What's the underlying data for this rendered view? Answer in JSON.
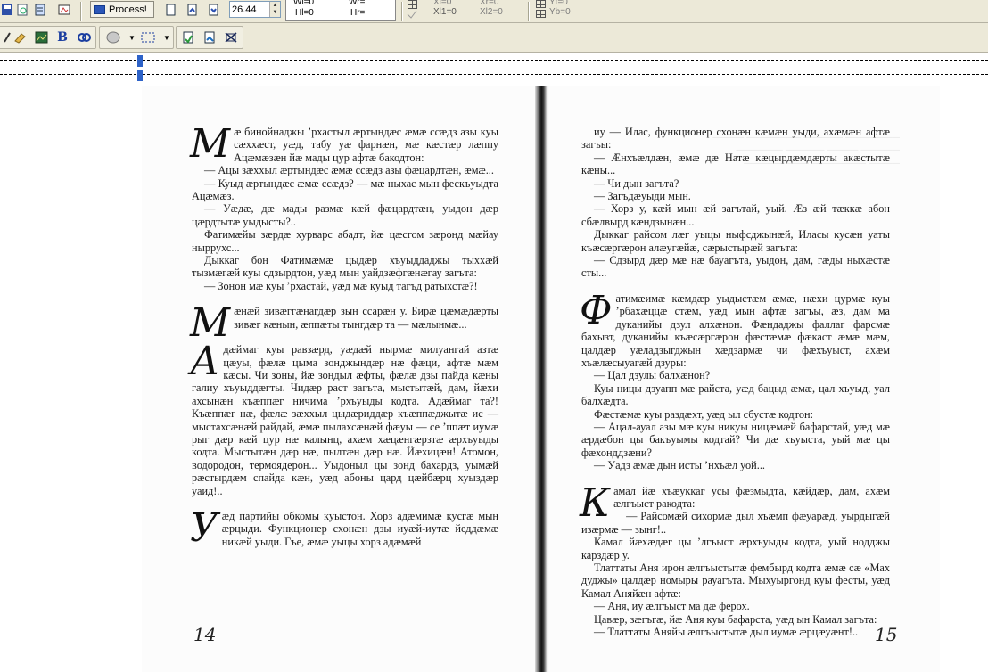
{
  "toolbar1": {
    "process_label": "Process!",
    "zoom_value": "26.44",
    "wl": "Wl=0",
    "hl": "Hl=0",
    "wr": "Wr=",
    "hr": "Hr=",
    "xl": "Xl=0",
    "xl1": "Xl1=0",
    "xl2": "Xl2=0",
    "xr": "Xr=0",
    "yt": "Yt=0",
    "yb": "Yb=0"
  },
  "page_left": {
    "page_number": "14",
    "sections": [
      {
        "dropcap": "М",
        "paragraphs": [
          "æ бинойнаджы ’рхастыл æртындæс æмæ ссæдз азы куы сæххæст, уæд, табу уæ фарнæн, мæ кæстæр лæппу Ацæмæзæн йæ мады цур афтæ бакодтон:",
          "— Ацы зæххыл æртындæс æмæ ссæдз азы фæцардтæн, æмæ...",
          "— Куыд æртындæс æмæ ссæдз? — мæ ныхас мын фескъуыдта Ацæмæз.",
          "— Уæдæ, дæ мады размæ кæй фæцардтæн, уыдон дæр цæрдтытæ уыдысты?..",
          "Фатимæйы зæрдæ хурварс абадт, йæ цæсгом зæронд мæйау ныррухс...",
          "Дыккаг бон Фатимæмæ цыдæр хъуыддаджы тыххæй тызмæгæй куы сдзырдтон, уæд мын уайдзæфгæнæгау загъта:",
          "— Зонон мæ куы ’рхастай, уæд мæ куыд тагъд ратыхстæ?!"
        ]
      },
      {
        "dropcap": "М",
        "paragraphs": [
          "æнæй зивæггæнагдæр зын ссарæн у. Бирæ цæмæдæрты зивæг кæнын, æппæты тынгдæр та — мæлынмæ..."
        ]
      },
      {
        "dropcap": "А",
        "paragraphs": [
          "дæймаг куы равзæрд, уæдæй нырмæ милуангай азтæ цæуы, фæлæ цыма зонджындæр нæ фæци, афтæ мæм кæсы. Чи зоны, йæ зондыл æфты, фæлæ дзы пайда кæны галиу хъуыддæгты. Чидæр раст загъта, мыстытæй, дам, йæхи ахсынæн къæппæг ничима ’рхъуыды кодта. Адæймаг та?! Къæппæг нæ, фæлæ зæххыл цыдæриддæр къæппæджытæ ис — мыстахсæнæй райдай, æмæ пылахсæнæй фæуы — се ’ппæт иумæ рыг дæр кæй цур нæ калынц, ахæм хæцæнгæрзтæ æрхъуыды кодта. Мыстытæн дæр нæ, пылтæн дæр нæ. Йæхицæн! Атомон, водородон, термоядерон... Уыдоныл цы зонд бахардз, уымæй рæстырдæм спайда кæн, уæд абоны цард цæйбæрц хуыздæр уаид!.."
        ]
      },
      {
        "dropcap": "У",
        "paragraphs": [
          "æд партийы обкомы куыстон. Хорз адæмимæ кусгæ мын æрцыди. Функционер схонæн дзы иуæй-иутæ йеддæмæ никæй уыди. Гъе, æмæ уыцы хорз адæмæй"
        ]
      }
    ]
  },
  "page_right": {
    "page_number": "15",
    "sections": [
      {
        "dropcap": "",
        "paragraphs": [
          "иу — Илас, функционер схонæн кæмæн уыди, ахæмæн афтæ загъы:",
          "— Æнхъæлдæн, æмæ дæ Натæ кæцырдæмдæрты акæстытæ кæны...",
          "— Чи дын загъта?",
          "— Загъдæуыди мын.",
          "— Хорз у, кæй мын æй загътай, уый. Æз æй тæккæ абон сбæлвырд кæндзынæн...",
          "Дыккаг райсом лæг уыцы ныфсджынæй, Иласы кусæн уаты къæсæргæрон алæугæйæ, сæрыстырæй загъта:",
          "— Сдзырд дæр мæ нæ бауагъта, уыдон, дам, гæды ныхæстæ сты..."
        ]
      },
      {
        "dropcap": "Ф",
        "paragraphs": [
          "атимæимæ кæмдæр уыдыстæм æмæ, нæхи цурмæ куы ’рбахæццæ стæм, уæд мын афтæ загъы, æз, дам ма дуканийы дзул алхæнон. Фæндаджы фаллаг фарсмæ бахызт, дуканийы къæсæргæрон фæстæмæ фæкаст æмæ мæм, цалдæр уæладзыгджын хæдзармæ чи фæхъуыст, ахæм хъæлæсыуагæй дзуры:",
          "— Цал дзулы балхæнон?",
          "Куы ницы дзуапп мæ райста, уæд бацыд æмæ, цал хъуыд, уал балхæдта.",
          "Фæстæмæ куы раздæхт, уæд ыл сбустæ кодтон:",
          "— Ацал-ауал азы мæ куы никуы ницæмæй бафарстай, уæд мæ æрдæбон цы бакъуымы кодтай? Чи дæ хъуыста, уый мæ цы фæхонддзæни?",
          "— Уадз æмæ дын исты ’нхъæл уой..."
        ]
      },
      {
        "dropcap": "К",
        "paragraphs": [
          "амал йæ хъæуккаг усы фæзмыдта, кæйдæр, дам, ахæм æлгъыст ракодта:",
          "— Райсомæй сихормæ дыл хъæмп фæуарæд, уырдыгæй изæрмæ — зынг!..",
          "Камал йæхæдæг цы ’лгъыст æрхъуыды кодта, уый нодджы карздæр у.",
          "Тлаттаты Аня ирон æлгъыстытæ фембырд кодта æмæ сæ «Мах дуджы» цалдæр номыры рауагъта. Мыхуыргонд куы фесты, уæд Камал Аняйæн афтæ:",
          "— Аня, иу æлгъыст ма дæ ферох.",
          "Цавæр, зæгъгæ, йæ Аня куы бафарста, уæд ын Камал загъта:",
          "— Тлаттаты Аняйы æлгъыстытæ дыл иумæ æрцæуæнт!.."
        ]
      }
    ]
  }
}
